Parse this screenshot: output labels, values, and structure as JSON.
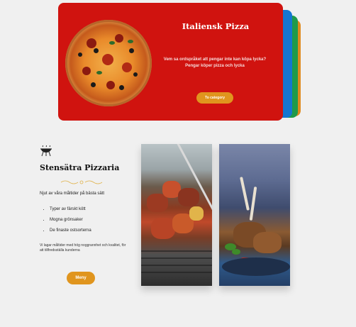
{
  "hero_card": {
    "title": "Italiensk Pizza",
    "description": "Vem sa ordspråket att pengar inte kan köpa lycka? Pengar köper pizza och lycka",
    "button_label": "To category"
  },
  "brand": {
    "name": "Stensätra Pizzaria",
    "intro": "Njut av våra måltider på bästa sätt",
    "features": [
      "Typer av färskt kött",
      "Mogna grönsaker",
      "De finaste ostsorterna"
    ],
    "note": "Vi lagar måltider med hög noggrannhet och kvalitet, för att tillfredsställa kunderna",
    "menu_button": "Meny"
  },
  "icons": {
    "logo": "grill-icon",
    "divider": "flourish-divider",
    "card_arrow": "chevron-right-icon"
  },
  "colors": {
    "background": "#f0f0f0",
    "card_red": "#d0130f",
    "accent_orange": "#e0951e",
    "card_blue": "#1576d1",
    "card_green": "#1f9a4a"
  }
}
